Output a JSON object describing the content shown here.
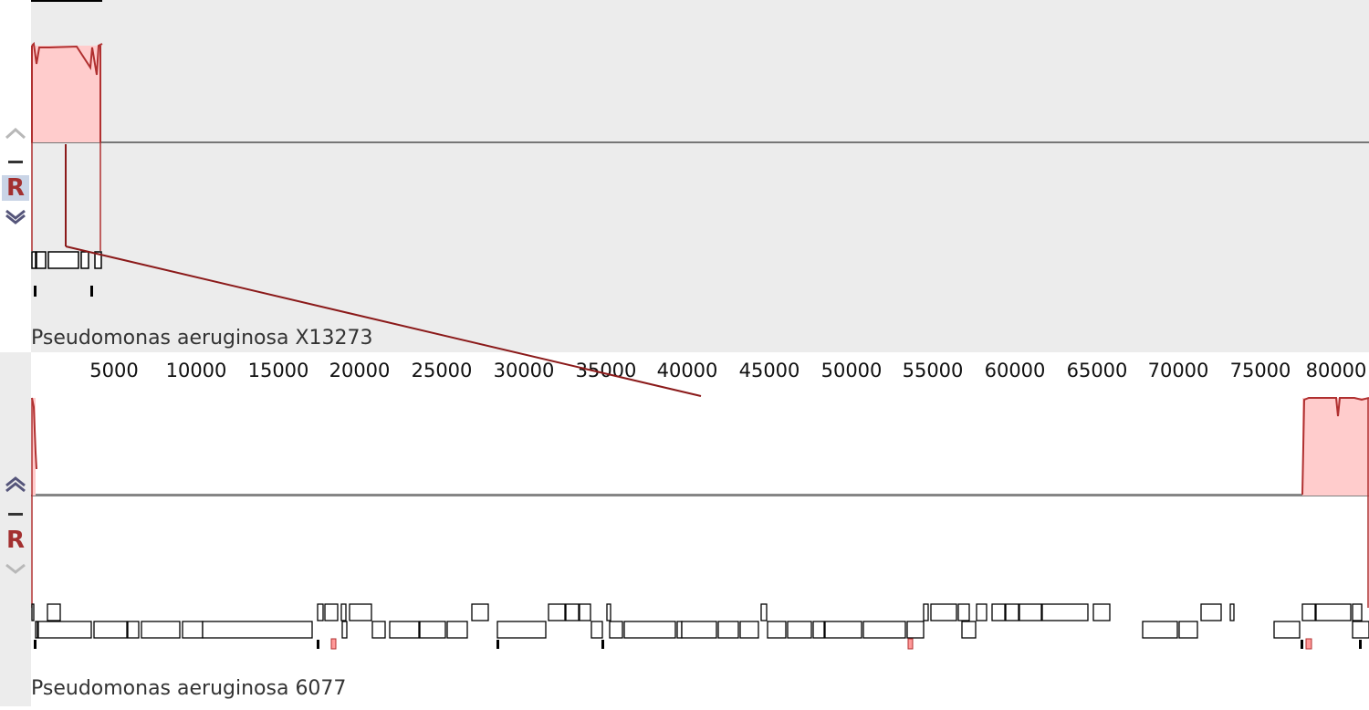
{
  "sequences": [
    {
      "name": "Pseudomonas aeruginosa X13273"
    },
    {
      "name": "Pseudomonas aeruginosa 6077"
    }
  ],
  "controls": {
    "r_label": "R"
  },
  "ruler": {
    "ticks": [
      "5000",
      "10000",
      "15000",
      "20000",
      "25000",
      "30000",
      "35000",
      "40000",
      "45000",
      "50000",
      "55000",
      "60000",
      "65000",
      "70000",
      "75000",
      "80000"
    ]
  },
  "colors": {
    "panel_bg_top": "#ececec",
    "panel_bg_bottom": "#ffffff",
    "block_fill": "#ffcccc",
    "block_edge": "#b03030",
    "connector": "#8b1a1a",
    "gene_box": "#000000",
    "gene_pink": "#ff9999"
  }
}
